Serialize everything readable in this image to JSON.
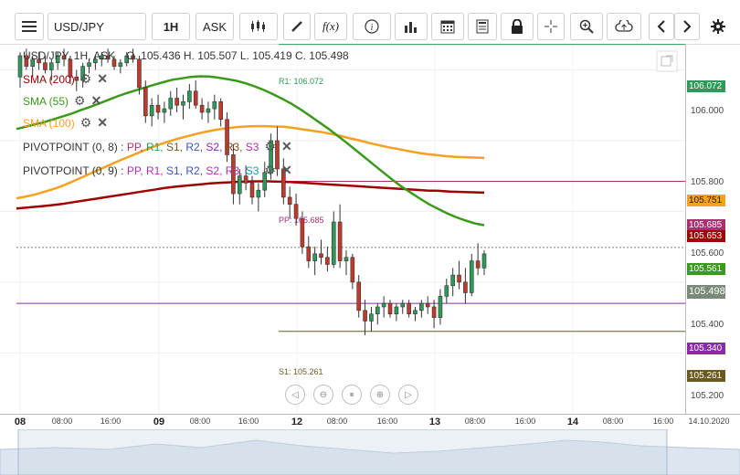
{
  "toolbar": {
    "symbol": "USD/JPY",
    "timeframe": "1H",
    "price_type": "ASK",
    "fx_label": "f(x)"
  },
  "legend": {
    "title": "USD/JPY, 1H, ASK",
    "ohlc": "O. 105.436 H. 105.507 L. 105.419 C. 105.498",
    "sma200": "SMA (200)",
    "sma55": "SMA (55)",
    "sma100": "SMA (100)",
    "pivot1_name": "PIVOTPOINT (0, 8)",
    "pivot2_name": "PIVOTPOINT (0, 9)",
    "pivot_sep": " : ",
    "pivot_items": [
      "PP,",
      "R1,",
      "S1,",
      "R2,",
      "S2,",
      "R3,",
      "S3"
    ]
  },
  "colors": {
    "sma200": "#a00000",
    "sma55": "#3a9a1a",
    "sma100": "#f5a020",
    "r1": "#2e9a5a",
    "pp": "#a8326f",
    "s1": "#6b5a20",
    "s2": "#8a2aa8",
    "up": "#2e9a5a",
    "down": "#c0392b"
  },
  "plot_labels": {
    "r1": "R1: 106.072",
    "pp": "PP: 105.685",
    "s1": "S1: 105.261"
  },
  "price_labels": {
    "r1": "106.072",
    "sma100": "105.751",
    "pp": "105.685",
    "sma200": "105.653",
    "sma55": "105.561",
    "last": "105.498",
    "s2": "105.340",
    "s1": "105.261"
  },
  "price_ticks": [
    "106.000",
    "105.800",
    "105.600",
    "105.400",
    "105.200"
  ],
  "time_ticks": [
    "08",
    "08:00",
    "16:00",
    "09",
    "08:00",
    "16:00",
    "12",
    "08:00",
    "16:00",
    "13",
    "08:00",
    "16:00",
    "14",
    "08:00",
    "16:00",
    "14.10.2020"
  ],
  "chart_data": {
    "type": "candlestick",
    "symbol": "USD/JPY",
    "interval": "1H",
    "ylim": [
      105.16,
      106.13
    ],
    "candles": [
      [
        105.98,
        106.05,
        105.95,
        106.04
      ],
      [
        106.04,
        106.06,
        106.0,
        106.01
      ],
      [
        106.01,
        106.04,
        105.98,
        106.03
      ],
      [
        106.03,
        106.05,
        106.0,
        106.02
      ],
      [
        106.02,
        106.04,
        105.99,
        106.0
      ],
      [
        106.0,
        106.03,
        105.97,
        106.02
      ],
      [
        106.02,
        106.05,
        106.0,
        106.04
      ],
      [
        106.04,
        106.06,
        106.01,
        106.03
      ],
      [
        106.03,
        106.04,
        105.96,
        105.98
      ],
      [
        105.98,
        106.0,
        105.94,
        105.97
      ],
      [
        105.97,
        106.02,
        105.95,
        106.01
      ],
      [
        106.01,
        106.03,
        105.99,
        106.02
      ],
      [
        106.02,
        106.04,
        106.0,
        106.03
      ],
      [
        106.03,
        106.05,
        106.01,
        106.04
      ],
      [
        106.04,
        106.06,
        106.02,
        106.03
      ],
      [
        106.03,
        106.04,
        106.0,
        106.01
      ],
      [
        106.01,
        106.03,
        105.99,
        106.02
      ],
      [
        106.02,
        106.05,
        106.01,
        106.04
      ],
      [
        106.04,
        106.06,
        106.02,
        106.03
      ],
      [
        106.03,
        106.04,
        105.93,
        105.95
      ],
      [
        105.95,
        105.97,
        105.85,
        105.87
      ],
      [
        105.87,
        105.92,
        105.84,
        105.9
      ],
      [
        105.9,
        105.93,
        105.86,
        105.88
      ],
      [
        105.88,
        105.91,
        105.85,
        105.89
      ],
      [
        105.89,
        105.94,
        105.87,
        105.92
      ],
      [
        105.92,
        105.95,
        105.88,
        105.9
      ],
      [
        105.9,
        105.93,
        105.86,
        105.91
      ],
      [
        105.91,
        105.96,
        105.89,
        105.94
      ],
      [
        105.94,
        105.97,
        105.89,
        105.9
      ],
      [
        105.9,
        105.92,
        105.86,
        105.88
      ],
      [
        105.88,
        105.91,
        105.85,
        105.89
      ],
      [
        105.89,
        105.93,
        105.86,
        105.91
      ],
      [
        105.91,
        105.92,
        105.84,
        105.86
      ],
      [
        105.86,
        105.88,
        105.74,
        105.76
      ],
      [
        105.76,
        105.79,
        105.62,
        105.65
      ],
      [
        105.65,
        105.72,
        105.62,
        105.7
      ],
      [
        105.7,
        105.73,
        105.66,
        105.68
      ],
      [
        105.68,
        105.7,
        105.62,
        105.64
      ],
      [
        105.64,
        105.68,
        105.6,
        105.66
      ],
      [
        105.66,
        105.74,
        105.64,
        105.71
      ],
      [
        105.71,
        105.82,
        105.69,
        105.8
      ],
      [
        105.8,
        105.84,
        105.7,
        105.72
      ],
      [
        105.72,
        105.75,
        105.62,
        105.64
      ],
      [
        105.64,
        105.67,
        105.58,
        105.62
      ],
      [
        105.62,
        105.65,
        105.56,
        105.58
      ],
      [
        105.58,
        105.6,
        105.48,
        105.5
      ],
      [
        105.5,
        105.53,
        105.44,
        105.46
      ],
      [
        105.46,
        105.5,
        105.42,
        105.48
      ],
      [
        105.48,
        105.52,
        105.45,
        105.47
      ],
      [
        105.47,
        105.5,
        105.43,
        105.45
      ],
      [
        105.45,
        105.6,
        105.44,
        105.57
      ],
      [
        105.57,
        105.62,
        105.44,
        105.46
      ],
      [
        105.46,
        105.49,
        105.42,
        105.47
      ],
      [
        105.47,
        105.48,
        105.38,
        105.4
      ],
      [
        105.4,
        105.42,
        105.3,
        105.32
      ],
      [
        105.32,
        105.35,
        105.25,
        105.29
      ],
      [
        105.29,
        105.33,
        105.26,
        105.31
      ],
      [
        105.31,
        105.34,
        105.28,
        105.33
      ],
      [
        105.33,
        105.36,
        105.3,
        105.34
      ],
      [
        105.34,
        105.35,
        105.3,
        105.31
      ],
      [
        105.31,
        105.34,
        105.29,
        105.33
      ],
      [
        105.33,
        105.35,
        105.31,
        105.34
      ],
      [
        105.34,
        105.35,
        105.3,
        105.31
      ],
      [
        105.31,
        105.33,
        105.29,
        105.32
      ],
      [
        105.32,
        105.35,
        105.3,
        105.34
      ],
      [
        105.34,
        105.36,
        105.31,
        105.33
      ],
      [
        105.33,
        105.35,
        105.27,
        105.3
      ],
      [
        105.3,
        105.38,
        105.28,
        105.36
      ],
      [
        105.36,
        105.41,
        105.34,
        105.39
      ],
      [
        105.39,
        105.44,
        105.36,
        105.42
      ],
      [
        105.42,
        105.46,
        105.38,
        105.4
      ],
      [
        105.4,
        105.44,
        105.34,
        105.37
      ],
      [
        105.37,
        105.48,
        105.36,
        105.46
      ],
      [
        105.46,
        105.51,
        105.42,
        105.44
      ],
      [
        105.44,
        105.49,
        105.42,
        105.48
      ]
    ],
    "sma55": [
      105.833,
      105.839,
      105.846,
      105.852,
      105.86,
      105.868,
      105.876,
      105.886,
      105.895,
      105.905,
      105.915,
      105.925,
      105.934,
      105.942,
      105.95,
      105.958,
      105.965,
      105.972,
      105.976,
      105.98,
      105.982,
      105.981,
      105.978,
      105.974,
      105.969,
      105.962,
      105.953,
      105.943,
      105.931,
      105.918,
      105.904,
      105.888,
      105.87,
      105.852,
      105.834,
      105.814,
      105.794,
      105.773,
      105.752,
      105.731,
      105.71,
      105.689,
      105.67,
      105.653,
      105.636,
      105.62,
      105.607,
      105.594,
      105.583,
      105.574,
      105.566,
      105.561
    ],
    "sma100": [
      105.637,
      105.642,
      105.648,
      105.656,
      105.664,
      105.674,
      105.686,
      105.698,
      105.71,
      105.722,
      105.734,
      105.746,
      105.757,
      105.768,
      105.779,
      105.789,
      105.798,
      105.806,
      105.813,
      105.82,
      105.826,
      105.831,
      105.835,
      105.838,
      105.84,
      105.841,
      105.841,
      105.84,
      105.839,
      105.836,
      105.832,
      105.828,
      105.824,
      105.819,
      105.813,
      105.806,
      105.8,
      105.793,
      105.787,
      105.781,
      105.776,
      105.771,
      105.766,
      105.762,
      105.759,
      105.756,
      105.754,
      105.753,
      105.752,
      105.751
    ],
    "sma200": [
      105.608,
      105.611,
      105.614,
      105.617,
      105.621,
      105.626,
      105.631,
      105.636,
      105.641,
      105.646,
      105.651,
      105.656,
      105.661,
      105.666,
      105.67,
      105.673,
      105.676,
      105.679,
      105.681,
      105.683,
      105.684,
      105.685,
      105.685,
      105.684,
      105.683,
      105.681,
      105.679,
      105.677,
      105.675,
      105.673,
      105.671,
      105.669,
      105.667,
      105.665,
      105.663,
      105.661,
      105.659,
      105.658,
      105.656,
      105.655,
      105.654,
      105.653
    ],
    "pivot_levels": {
      "R1": 106.072,
      "PP": 105.685,
      "S1": 105.261,
      "S2": 105.34
    },
    "last_price": 105.498
  }
}
